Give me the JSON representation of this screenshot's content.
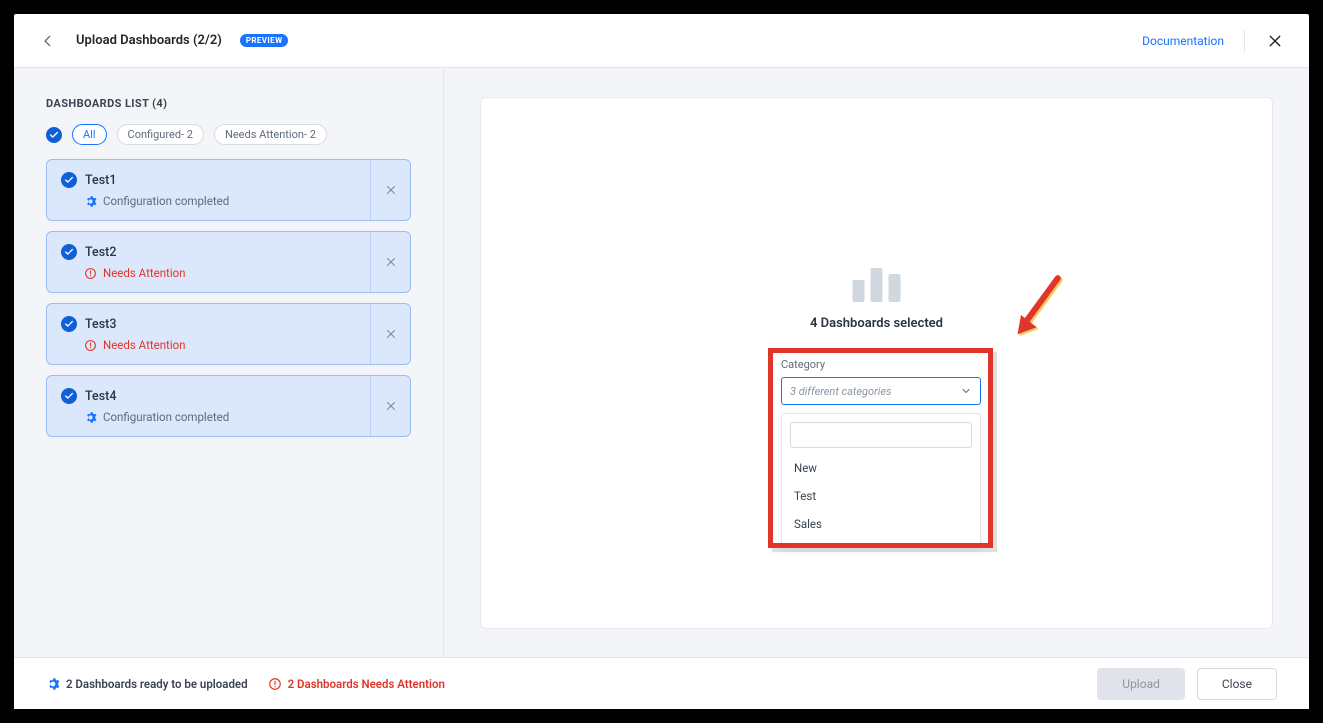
{
  "header": {
    "title": "Upload Dashboards (2/2)",
    "preview_badge": "PREVIEW",
    "documentation_label": "Documentation"
  },
  "sidebar": {
    "list_title": "DASHBOARDS LIST (4)",
    "filters": {
      "all": "All",
      "configured": "Configured- 2",
      "needs_attention": "Needs Attention- 2"
    },
    "items": [
      {
        "name": "Test1",
        "status": "Configuration completed",
        "state": "ok"
      },
      {
        "name": "Test2",
        "status": "Needs Attention",
        "state": "warn"
      },
      {
        "name": "Test3",
        "status": "Needs Attention",
        "state": "warn"
      },
      {
        "name": "Test4",
        "status": "Configuration completed",
        "state": "ok"
      }
    ]
  },
  "main": {
    "selected_text": "4 Dashboards selected",
    "category": {
      "label": "Category",
      "placeholder": "3 different categories",
      "options": [
        "New",
        "Test",
        "Sales"
      ]
    }
  },
  "footer": {
    "ready_text": "2 Dashboards ready to be uploaded",
    "warn_text": "2 Dashboards Needs Attention",
    "upload_label": "Upload",
    "close_label": "Close"
  }
}
